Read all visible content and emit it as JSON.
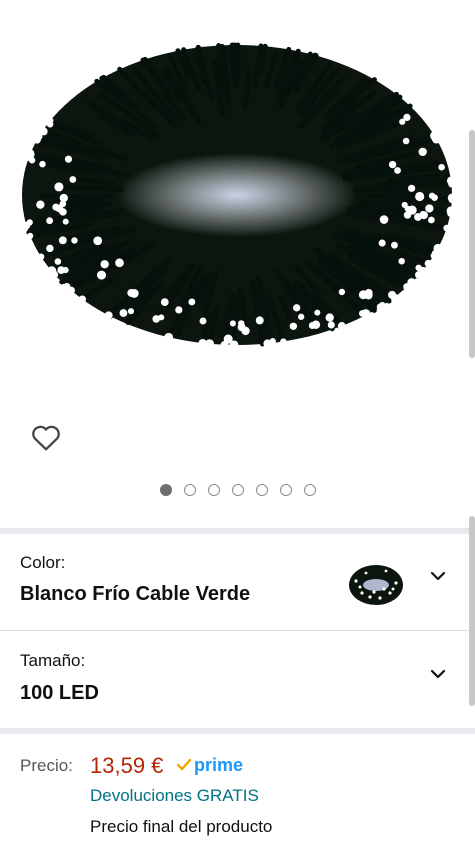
{
  "product": {
    "image_alt": "String of white LED fairy lights on dark green cable",
    "carousel": {
      "count": 7,
      "active": 0
    }
  },
  "options": {
    "color": {
      "label": "Color:",
      "value": "Blanco Frío Cable Verde"
    },
    "size": {
      "label": "Tamaño:",
      "value": "100 LED"
    }
  },
  "price": {
    "label": "Precio:",
    "value": "13,59 €",
    "prime_text": "prime",
    "returns": "Devoluciones GRATIS",
    "final_note": "Precio final del producto"
  },
  "colors": {
    "price": "#b12704",
    "link": "#007185",
    "prime": "#1a98ff"
  },
  "icons": {
    "wishlist": "heart-outline-icon",
    "dropdown": "chevron-down-icon",
    "prime_check": "checkmark-icon"
  }
}
